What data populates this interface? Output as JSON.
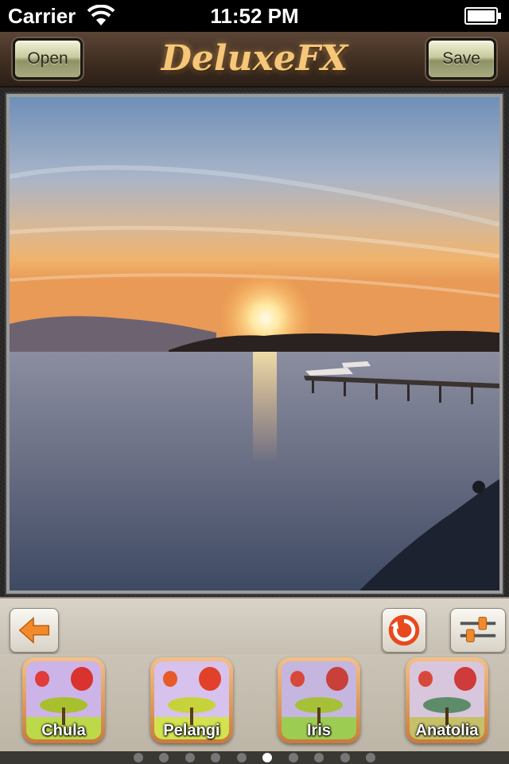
{
  "status_bar": {
    "carrier": "Carrier",
    "time": "11:52 PM"
  },
  "nav": {
    "title": "DeluxeFX",
    "open_label": "Open",
    "save_label": "Save"
  },
  "toolbar": {
    "icons": [
      "back-arrow-icon",
      "reset-icon",
      "adjust-sliders-icon"
    ]
  },
  "filters": [
    {
      "label": "Chula"
    },
    {
      "label": "Pelangi"
    },
    {
      "label": "Iris"
    },
    {
      "label": "Anatolia"
    }
  ],
  "pagination": {
    "count": 10,
    "active_index": 5
  },
  "colors": {
    "title": "#f6c77a",
    "filter_frame": "#e29a55"
  }
}
